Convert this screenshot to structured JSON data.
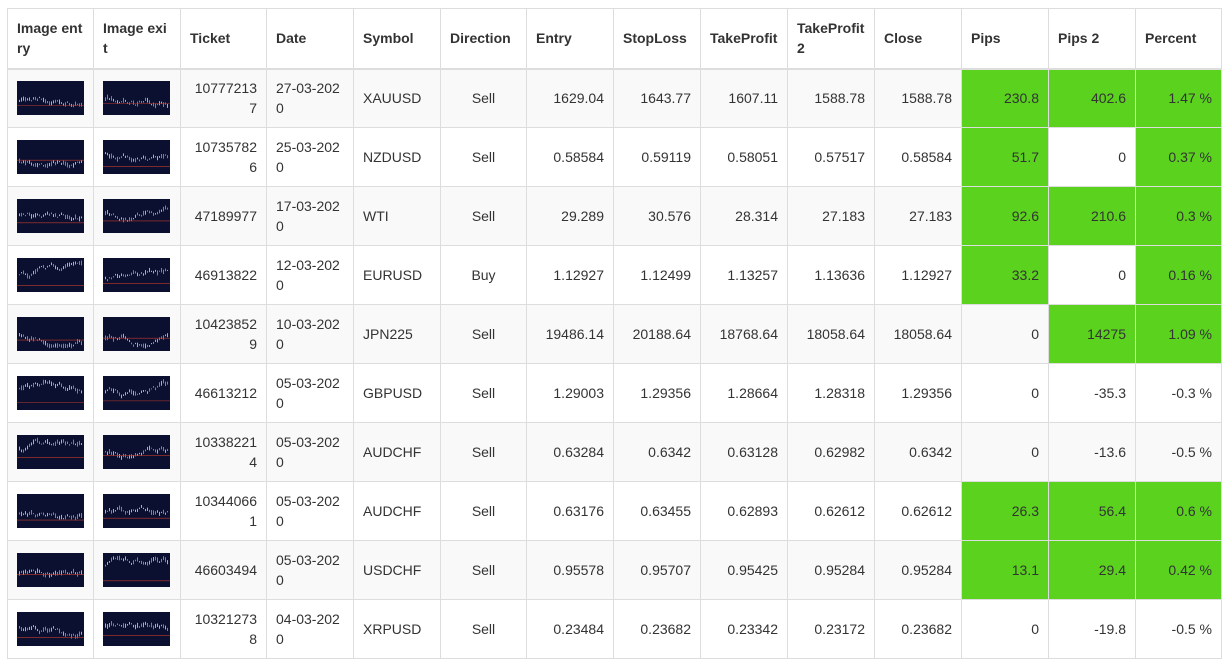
{
  "columns": [
    "Image entry",
    "Image exit",
    "Ticket",
    "Date",
    "Symbol",
    "Direction",
    "Entry",
    "StopLoss",
    "TakeProfit",
    "TakeProfit 2",
    "Close",
    "Pips",
    "Pips 2",
    "Percent"
  ],
  "colors": {
    "positive_fill": "#5bd21e",
    "stripe": "#f9f9f9",
    "border": "#dddddd",
    "text": "#333333",
    "thumbnail_bg": "#0b1030"
  },
  "thumbnail_icon": "chart-thumbnail-icon",
  "rows": [
    {
      "ticket": "107772137",
      "date": "27-03-2020",
      "symbol": "XAUUSD",
      "direction": "Sell",
      "entry": "1629.04",
      "stoploss": "1643.77",
      "takeprofit": "1607.11",
      "takeprofit2": "1588.78",
      "close": "1588.78",
      "pips": "230.8",
      "pips2": "402.6",
      "percent": "1.47 %",
      "pips_pos": true,
      "pips2_pos": true,
      "percent_pos": true
    },
    {
      "ticket": "107357826",
      "date": "25-03-2020",
      "symbol": "NZDUSD",
      "direction": "Sell",
      "entry": "0.58584",
      "stoploss": "0.59119",
      "takeprofit": "0.58051",
      "takeprofit2": "0.57517",
      "close": "0.58584",
      "pips": "51.7",
      "pips2": "0",
      "percent": "0.37 %",
      "pips_pos": true,
      "pips2_pos": false,
      "percent_pos": true
    },
    {
      "ticket": "47189977",
      "date": "17-03-2020",
      "symbol": "WTI",
      "direction": "Sell",
      "entry": "29.289",
      "stoploss": "30.576",
      "takeprofit": "28.314",
      "takeprofit2": "27.183",
      "close": "27.183",
      "pips": "92.6",
      "pips2": "210.6",
      "percent": "0.3 %",
      "pips_pos": true,
      "pips2_pos": true,
      "percent_pos": true
    },
    {
      "ticket": "46913822",
      "date": "12-03-2020",
      "symbol": "EURUSD",
      "direction": "Buy",
      "entry": "1.12927",
      "stoploss": "1.12499",
      "takeprofit": "1.13257",
      "takeprofit2": "1.13636",
      "close": "1.12927",
      "pips": "33.2",
      "pips2": "0",
      "percent": "0.16 %",
      "pips_pos": true,
      "pips2_pos": false,
      "percent_pos": true
    },
    {
      "ticket": "104238529",
      "date": "10-03-2020",
      "symbol": "JPN225",
      "direction": "Sell",
      "entry": "19486.14",
      "stoploss": "20188.64",
      "takeprofit": "18768.64",
      "takeprofit2": "18058.64",
      "close": "18058.64",
      "pips": "0",
      "pips2": "14275",
      "percent": "1.09 %",
      "pips_pos": false,
      "pips2_pos": true,
      "percent_pos": true
    },
    {
      "ticket": "46613212",
      "date": "05-03-2020",
      "symbol": "GBPUSD",
      "direction": "Sell",
      "entry": "1.29003",
      "stoploss": "1.29356",
      "takeprofit": "1.28664",
      "takeprofit2": "1.28318",
      "close": "1.29356",
      "pips": "0",
      "pips2": "-35.3",
      "percent": "-0.3 %",
      "pips_pos": false,
      "pips2_pos": false,
      "percent_pos": false
    },
    {
      "ticket": "103382214",
      "date": "05-03-2020",
      "symbol": "AUDCHF",
      "direction": "Sell",
      "entry": "0.63284",
      "stoploss": "0.6342",
      "takeprofit": "0.63128",
      "takeprofit2": "0.62982",
      "close": "0.6342",
      "pips": "0",
      "pips2": "-13.6",
      "percent": "-0.5 %",
      "pips_pos": false,
      "pips2_pos": false,
      "percent_pos": false
    },
    {
      "ticket": "103440661",
      "date": "05-03-2020",
      "symbol": "AUDCHF",
      "direction": "Sell",
      "entry": "0.63176",
      "stoploss": "0.63455",
      "takeprofit": "0.62893",
      "takeprofit2": "0.62612",
      "close": "0.62612",
      "pips": "26.3",
      "pips2": "56.4",
      "percent": "0.6 %",
      "pips_pos": true,
      "pips2_pos": true,
      "percent_pos": true
    },
    {
      "ticket": "46603494",
      "date": "05-03-2020",
      "symbol": "USDCHF",
      "direction": "Sell",
      "entry": "0.95578",
      "stoploss": "0.95707",
      "takeprofit": "0.95425",
      "takeprofit2": "0.95284",
      "close": "0.95284",
      "pips": "13.1",
      "pips2": "29.4",
      "percent": "0.42 %",
      "pips_pos": true,
      "pips2_pos": true,
      "percent_pos": true
    },
    {
      "ticket": "103212738",
      "date": "04-03-2020",
      "symbol": "XRPUSD",
      "direction": "Sell",
      "entry": "0.23484",
      "stoploss": "0.23682",
      "takeprofit": "0.23342",
      "takeprofit2": "0.23172",
      "close": "0.23682",
      "pips": "0",
      "pips2": "-19.8",
      "percent": "-0.5 %",
      "pips_pos": false,
      "pips2_pos": false,
      "percent_pos": false
    }
  ]
}
